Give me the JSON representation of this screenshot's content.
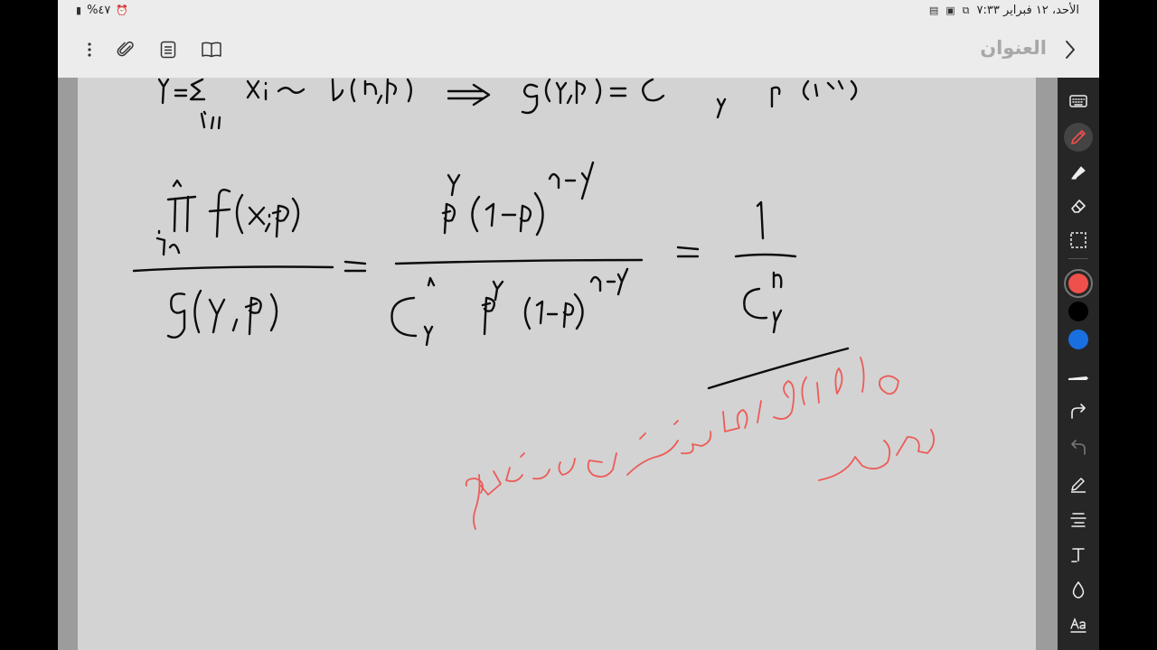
{
  "status_bar": {
    "datetime": "الأحد، ١٢ فبراير  ٧:٣٣",
    "battery": "%٤٧"
  },
  "toolbar": {
    "title": "العنوان"
  },
  "icons": {
    "back": "chevron-right-icon",
    "menu": "more-vertical-icon",
    "attach": "paperclip-icon",
    "pages": "document-icon",
    "reader": "book-icon"
  },
  "tools": [
    {
      "name": "keyboard-tool",
      "icon": "keyboard-icon"
    },
    {
      "name": "pen-tool",
      "icon": "pen-icon",
      "active": true
    },
    {
      "name": "highlighter-tool",
      "icon": "highlighter-icon"
    },
    {
      "name": "eraser-tool",
      "icon": "eraser-icon"
    },
    {
      "name": "lasso-select-tool",
      "icon": "dashed-select-icon"
    },
    {
      "name": "color-red",
      "icon": "color-swatch-icon",
      "color": "#f0504b"
    },
    {
      "name": "color-black",
      "icon": "color-swatch-icon",
      "color": "#000000"
    },
    {
      "name": "color-blue",
      "icon": "color-swatch-icon",
      "color": "#1a6fe0"
    },
    {
      "name": "stroke-width-tool",
      "icon": "line-thickness-icon"
    },
    {
      "name": "redo-button",
      "icon": "redo-icon"
    },
    {
      "name": "undo-button",
      "icon": "undo-icon"
    },
    {
      "name": "pen-edit-tool",
      "icon": "pen-edit-icon"
    },
    {
      "name": "text-align-tool",
      "icon": "text-lines-icon"
    },
    {
      "name": "text-tool",
      "icon": "text-T-icon"
    },
    {
      "name": "shape-tool",
      "icon": "drop-shape-icon"
    },
    {
      "name": "text-format-tool",
      "icon": "text-format-icon"
    }
  ],
  "colors": {
    "ink": "#0c0c0c",
    "annotation": "#ec5b57",
    "page": "#d3d3d3",
    "toolbar": "#ececec",
    "tool_panel": "#262626"
  }
}
